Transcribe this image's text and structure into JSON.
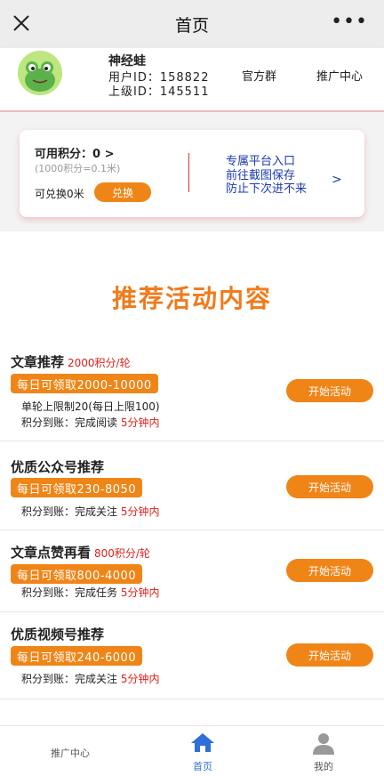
{
  "topbar": {
    "title": "首页",
    "close_icon": "close-icon",
    "more_icon": "more-icon"
  },
  "user": {
    "name": "神经蛙",
    "user_id": "用户ID：158822",
    "parent_id": "上级ID：145511",
    "group_link": "官方群",
    "promo_link": "推广中心",
    "avatar": "frog-avatar"
  },
  "points": {
    "label": "可用积分：0 >",
    "note": "(1000积分=0.1米)",
    "exchange_text": "可兑换0米",
    "exchange_button": "兑换",
    "entry_title": "专属平台入口",
    "entry_line1": "前往截图保存",
    "entry_line2": "防止下次进不来",
    "entry_arrow": ">"
  },
  "section_title": "推荐活动内容",
  "activities": [
    {
      "name": "文章推荐",
      "rate": "2000积分/轮",
      "daily": "每日可领取2000-10000",
      "extra": "单轮上限制20(每日上限100)",
      "settle_prefix": "积分到账：完成阅读",
      "settle_time": "5分钟内",
      "button": "开始活动"
    },
    {
      "name": "优质公众号推荐",
      "rate": "",
      "daily": "每日可领取230-8050",
      "extra": "",
      "settle_prefix": "积分到账：完成关注",
      "settle_time": "5分钟内",
      "button": "开始活动"
    },
    {
      "name": "文章点赞再看",
      "rate": "800积分/轮",
      "daily": "每日可领取800-4000",
      "extra": "",
      "settle_prefix": "积分到账：完成任务",
      "settle_time": "5分钟内",
      "button": "开始活动"
    },
    {
      "name": "优质视频号推荐",
      "rate": "",
      "daily": "每日可领取240-6000",
      "extra": "",
      "settle_prefix": "积分到账：完成关注",
      "settle_time": "5分钟内",
      "button": "开始活动"
    }
  ],
  "nav": {
    "items": [
      {
        "label": "推广中心",
        "icon": ""
      },
      {
        "label": "首页",
        "icon": "home-icon"
      },
      {
        "label": "我的",
        "icon": "user-icon"
      }
    ],
    "active_color": "#2f6fd6"
  },
  "colors": {
    "accent": "#f08517",
    "title_orange": "#ef7b1c",
    "red": "#e0201c",
    "link_blue": "#1a3bb0"
  }
}
